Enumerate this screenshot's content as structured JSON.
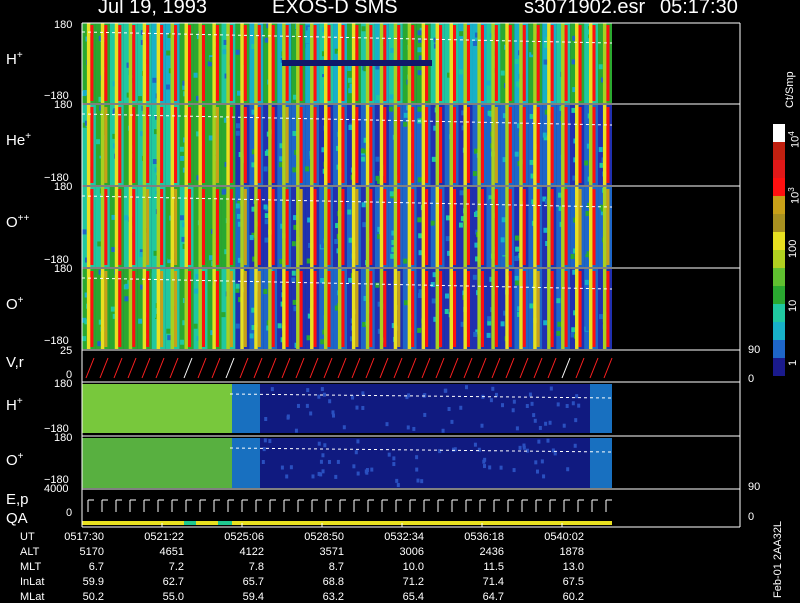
{
  "header": {
    "date": "Jul 19, 1993",
    "instrument": "EXOS-D SMS",
    "file": "s3071902.esr",
    "time": "05:17:30"
  },
  "colors": {
    "background": "#000000",
    "axis": "#ffffff",
    "trace": "#ff2020"
  },
  "panels": [
    {
      "label": "H",
      "charge": "+",
      "top_tick": "180",
      "bottom_tick": "−180"
    },
    {
      "label": "He",
      "charge": "+",
      "top_tick": "180",
      "bottom_tick": "−180"
    },
    {
      "label": "O",
      "charge": "++",
      "top_tick": "180",
      "bottom_tick": "−180"
    },
    {
      "label": "O",
      "charge": "+",
      "top_tick": "180",
      "bottom_tick": "−180"
    }
  ],
  "vr_panel": {
    "label": "V,r",
    "left_top": "25",
    "left_zero": "0",
    "right_top": "90",
    "right_bottom": "0"
  },
  "lower_panels": [
    {
      "label": "H",
      "charge": "+",
      "top_tick": "180",
      "bottom_tick": "−180"
    },
    {
      "label": "O",
      "charge": "+",
      "top_tick": "180",
      "bottom_tick": "−180"
    }
  ],
  "ep_panel": {
    "label1": "E,p",
    "label2": "QA",
    "left_top": "4000",
    "left_zero": "0",
    "right_top": "90",
    "right_bottom": "0"
  },
  "colorbar": {
    "unit": "Ct/Smp",
    "ticks": [
      "10",
      "10",
      "100",
      "10",
      "1"
    ],
    "tick_exp": [
      "4",
      "3",
      "",
      "",
      ""
    ]
  },
  "chart_data": {
    "type": "heatmap",
    "title": "Jul 19, 1993 EXOS-D SMS",
    "x_ticks": [
      "0517:30",
      "0521:22",
      "0525:06",
      "0528:50",
      "0532:34",
      "0536:18",
      "0540:02"
    ],
    "y_range": [
      -180,
      180
    ],
    "colorscale": "log",
    "colorbar_range": [
      1,
      10000
    ],
    "panel_series": [
      "H+",
      "He+",
      "O++",
      "O+",
      "V,r",
      "H+",
      "O+",
      "E,p QA"
    ],
    "ephemeris": [
      {
        "name": "UT",
        "values": [
          "0517:30",
          "0521:22",
          "0525:06",
          "0528:50",
          "0532:34",
          "0536:18",
          "0540:02"
        ]
      },
      {
        "name": "ALT",
        "values": [
          "5170",
          "4651",
          "4122",
          "3571",
          "3006",
          "2436",
          "1878"
        ]
      },
      {
        "name": "MLT",
        "values": [
          "6.7",
          "7.2",
          "7.8",
          "8.7",
          "10.0",
          "11.5",
          "13.0"
        ]
      },
      {
        "name": "InLat",
        "values": [
          "59.9",
          "62.7",
          "65.7",
          "68.8",
          "71.2",
          "71.4",
          "67.5"
        ]
      },
      {
        "name": "MLat",
        "values": [
          "50.2",
          "55.0",
          "59.4",
          "63.2",
          "65.4",
          "64.7",
          "60.2"
        ]
      }
    ]
  },
  "footer": "Feb-01 2AA32L"
}
